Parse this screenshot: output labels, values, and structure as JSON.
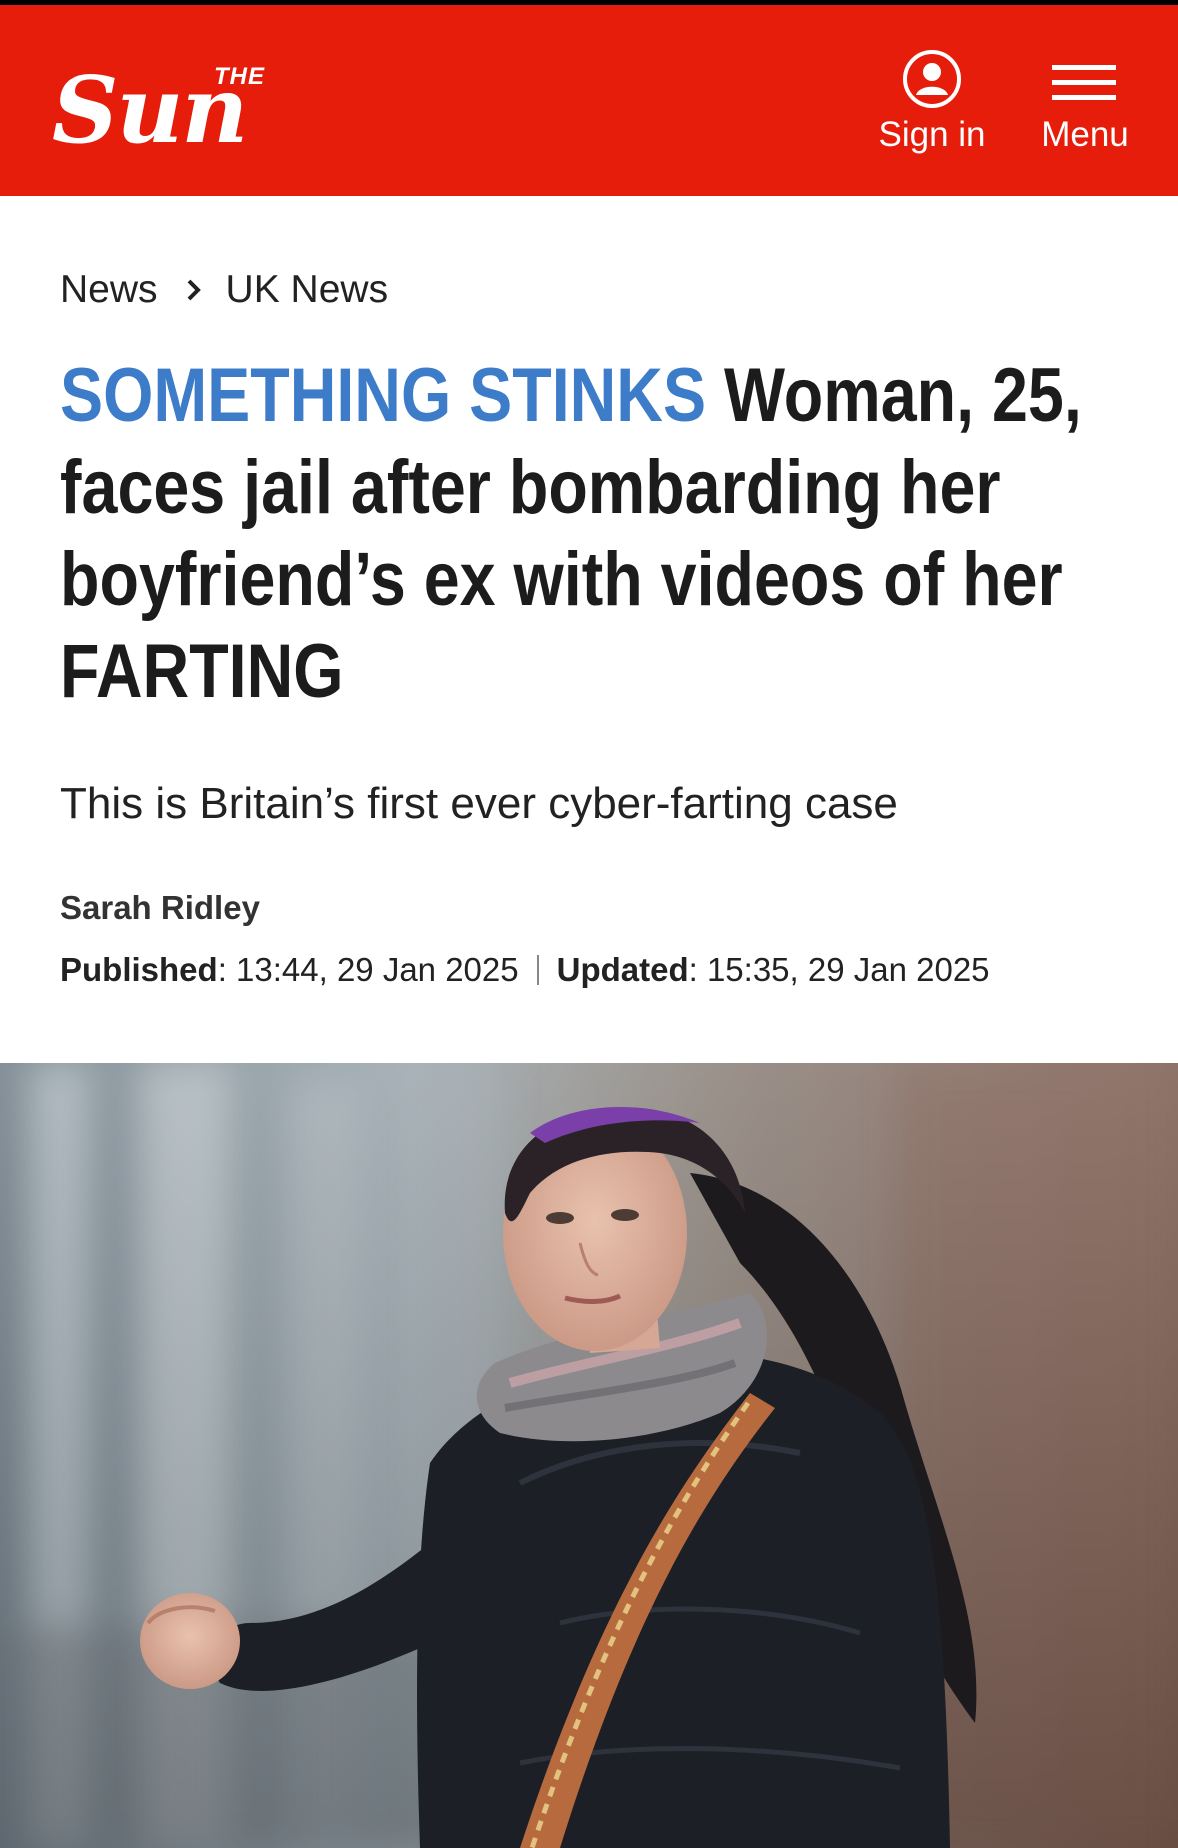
{
  "header": {
    "logo_the": "THE",
    "logo_sun": "Sun",
    "sign_in_label": "Sign in",
    "menu_label": "Menu",
    "brand_color": "#e71d0c"
  },
  "breadcrumb": {
    "items": [
      "News",
      "UK News"
    ]
  },
  "article": {
    "kicker": "SOMETHING STINKS",
    "headline": "Woman, 25, faces jail after bombarding her boyfriend’s ex with videos of her FARTING",
    "kicker_color": "#3d7cc9",
    "standfirst": "This is Britain’s first ever cyber-farting case",
    "author": "Sarah Ridley",
    "published_label": "Published",
    "published_value": ": 13:44, 29 Jan 2025",
    "updated_label": "Updated",
    "updated_value": ": 15:35, 29 Jan 2025"
  }
}
